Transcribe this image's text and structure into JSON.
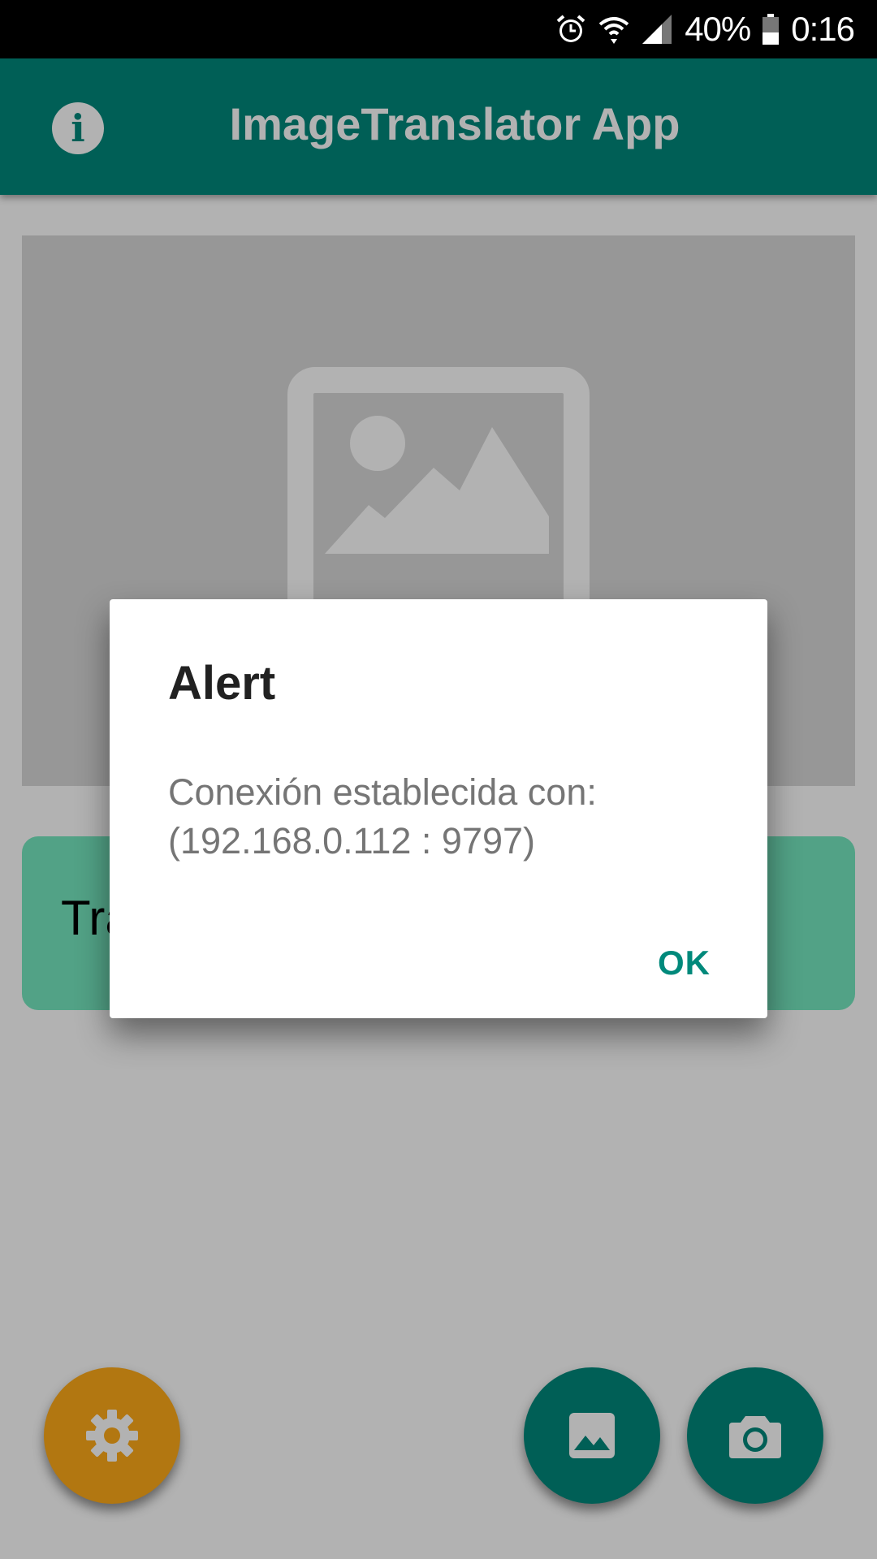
{
  "status_bar": {
    "battery_percent": "40%",
    "time": "0:16",
    "icons": [
      "alarm-icon",
      "wifi-icon",
      "signal-icon",
      "battery-icon"
    ]
  },
  "app_bar": {
    "title": "ImageTranslator App",
    "info_icon": "info-icon"
  },
  "image_preview": {
    "placeholder_icon": "image-placeholder-icon"
  },
  "translate_card": {
    "visible_text": "Tra"
  },
  "fabs": {
    "settings_icon": "gear-icon",
    "gallery_icon": "gallery-icon",
    "camera_icon": "camera-icon"
  },
  "dialog": {
    "title": "Alert",
    "message_line1": "Conexión establecida con:",
    "message_line2": "(192.168.0.112 : 9797)",
    "ok_label": "OK"
  },
  "colors": {
    "primary": "#00897b",
    "accent_orange": "#ffab19",
    "card_green": "#76e8c0"
  }
}
